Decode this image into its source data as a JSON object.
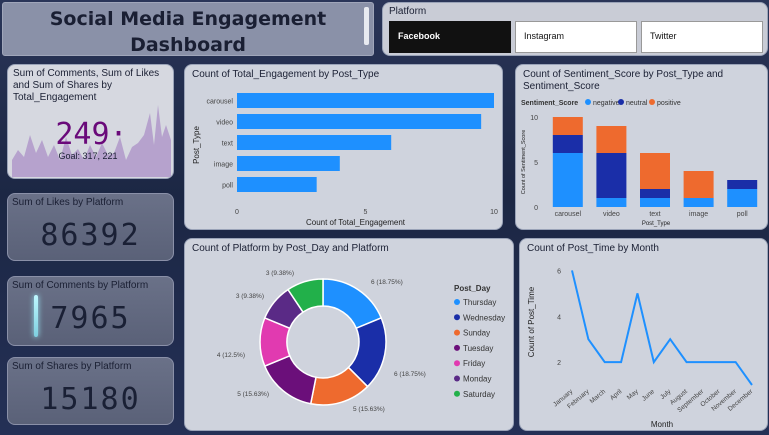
{
  "header": {
    "title_line1": "Social Media Engagement",
    "title_line2": "Dashboard"
  },
  "slicer": {
    "title": "Platform",
    "options": [
      "Facebook",
      "Instagram",
      "Twitter"
    ],
    "selected": "Facebook"
  },
  "kpi_sparkline": {
    "title": "Sum of Comments, Sum of Likes and Sum of Shares by Total_Engagement",
    "value": "249·",
    "goal": "Goal: 317, 221"
  },
  "kpis": {
    "likes": {
      "title": "Sum of Likes by Platform",
      "value": "86392"
    },
    "comments": {
      "title": "Sum of Comments by Platform",
      "value": "7965"
    },
    "shares": {
      "title": "Sum of Shares by Platform",
      "value": "15180"
    }
  },
  "colors": {
    "bar_blue": "#1e90ff",
    "negative": "#1e90ff",
    "neutral": "#1a2ea8",
    "positive": "#ee6a2e",
    "slicer_selected_bg": "#111111",
    "donut": [
      "#1e90ff",
      "#1a2ea8",
      "#ee6a2e",
      "#6b0f7a",
      "#e13ab0",
      "#5a2a86",
      "#22b04a"
    ]
  },
  "chart_data": [
    {
      "id": "engagement_by_type",
      "type": "bar",
      "orientation": "horizontal",
      "title": "Count of Total_Engagement by Post_Type",
      "xlabel": "Count of Total_Engagement",
      "ylabel": "Post_Type",
      "categories": [
        "carousel",
        "video",
        "text",
        "image",
        "poll"
      ],
      "values": [
        10,
        9.5,
        6,
        4,
        3.1
      ],
      "xlim": [
        0,
        10
      ],
      "xticks": [
        "0",
        "5",
        "10"
      ]
    },
    {
      "id": "sentiment_by_type",
      "type": "bar",
      "stacked": true,
      "title": "Count of Sentiment_Score by Post_Type and Sentiment_Score",
      "xlabel": "Post_Type",
      "ylabel": "Count of Sentiment_Score",
      "legend_title": "Sentiment_Score",
      "categories": [
        "carousel",
        "video",
        "text",
        "image",
        "poll"
      ],
      "series": [
        {
          "name": "negative",
          "values": [
            6,
            1,
            1,
            1,
            2
          ]
        },
        {
          "name": "neutral",
          "values": [
            2,
            5,
            1,
            0,
            1
          ]
        },
        {
          "name": "positive",
          "values": [
            2,
            3,
            4,
            3,
            0
          ]
        }
      ],
      "ylim": [
        0,
        10
      ],
      "yticks": [
        "0",
        "5",
        "10"
      ]
    },
    {
      "id": "platform_by_day",
      "type": "pie",
      "donut": true,
      "title": "Count of Platform by Post_Day and Platform",
      "legend_title": "Post_Day",
      "labels": [
        "Thursday",
        "Wednesday",
        "Sunday",
        "Tuesday",
        "Friday",
        "Monday",
        "Saturday"
      ],
      "values": [
        6,
        6,
        5,
        5,
        4,
        3,
        3
      ],
      "data_labels": [
        "6 (18.75%)",
        "6 (18.75%)",
        "5 (15.63%)",
        "5 (15.63%)",
        "4 (12.5%)",
        "3 (9.38%)",
        "3 (9.38%)"
      ]
    },
    {
      "id": "post_time_by_month",
      "type": "line",
      "title": "Count of Post_Time by Month",
      "xlabel": "Month",
      "ylabel": "Count of Post_Time",
      "x": [
        "January",
        "February",
        "March",
        "April",
        "May",
        "June",
        "July",
        "August",
        "September",
        "October",
        "November",
        "December"
      ],
      "y": [
        6,
        3,
        2,
        2,
        5,
        2,
        3,
        2,
        2,
        2,
        2,
        1
      ],
      "ylim": [
        1,
        6.5
      ],
      "yticks": [
        "2",
        "4",
        "6"
      ]
    }
  ]
}
